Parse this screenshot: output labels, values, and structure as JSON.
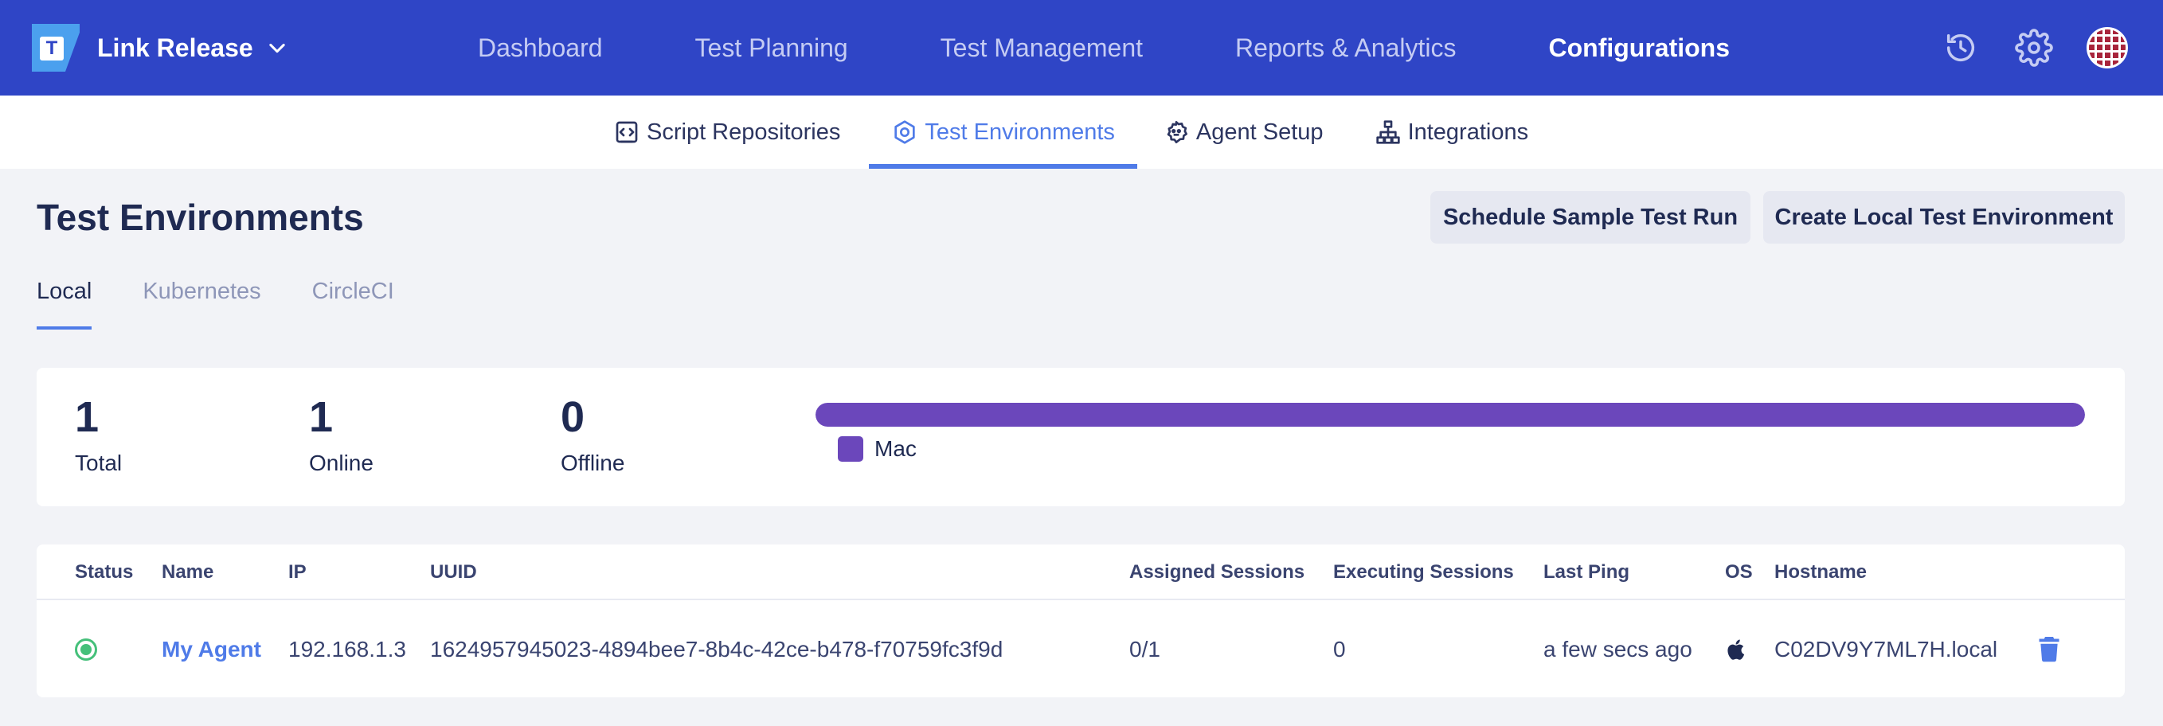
{
  "topbar": {
    "project_name": "Link Release",
    "logo_letter": "T",
    "nav": [
      {
        "label": "Dashboard"
      },
      {
        "label": "Test Planning"
      },
      {
        "label": "Test Management"
      },
      {
        "label": "Reports & Analytics"
      },
      {
        "label": "Configurations",
        "active": true
      }
    ],
    "icons": [
      "history-icon",
      "gear-icon",
      "avatar"
    ],
    "brand_color": "#2f45c6"
  },
  "subnav": {
    "items": [
      {
        "label": "Script Repositories",
        "icon": "code-icon"
      },
      {
        "label": "Test Environments",
        "icon": "hexagon-icon",
        "active": true
      },
      {
        "label": "Agent Setup",
        "icon": "agent-gear-icon"
      },
      {
        "label": "Integrations",
        "icon": "network-icon"
      }
    ],
    "accent_color": "#4f7be8"
  },
  "page": {
    "title": "Test Environments",
    "buttons": {
      "schedule": "Schedule Sample Test Run",
      "create": "Create Local Test Environment"
    },
    "tabs": [
      {
        "label": "Local",
        "active": true
      },
      {
        "label": "Kubernetes"
      },
      {
        "label": "CircleCI"
      }
    ]
  },
  "stats": {
    "total": {
      "value": "1",
      "label": "Total"
    },
    "online": {
      "value": "1",
      "label": "Online"
    },
    "offline": {
      "value": "0",
      "label": "Offline"
    },
    "os_distribution": [
      {
        "name": "Mac",
        "fraction": 1.0,
        "color": "#6b47bb"
      }
    ]
  },
  "table": {
    "columns": [
      "Status",
      "Name",
      "IP",
      "UUID",
      "Assigned Sessions",
      "Executing Sessions",
      "Last Ping",
      "OS",
      "Hostname"
    ],
    "rows": [
      {
        "status": "online",
        "name": "My Agent",
        "ip": "192.168.1.3",
        "uuid": "1624957945023-4894bee7-8b4c-42ce-b478-f70759fc3f9d",
        "assigned_sessions": "0/1",
        "executing_sessions": "0",
        "last_ping": "a few secs ago",
        "os": "apple-icon",
        "hostname": "C02DV9Y7ML7H.local",
        "status_color": "#45c07a"
      }
    ]
  }
}
